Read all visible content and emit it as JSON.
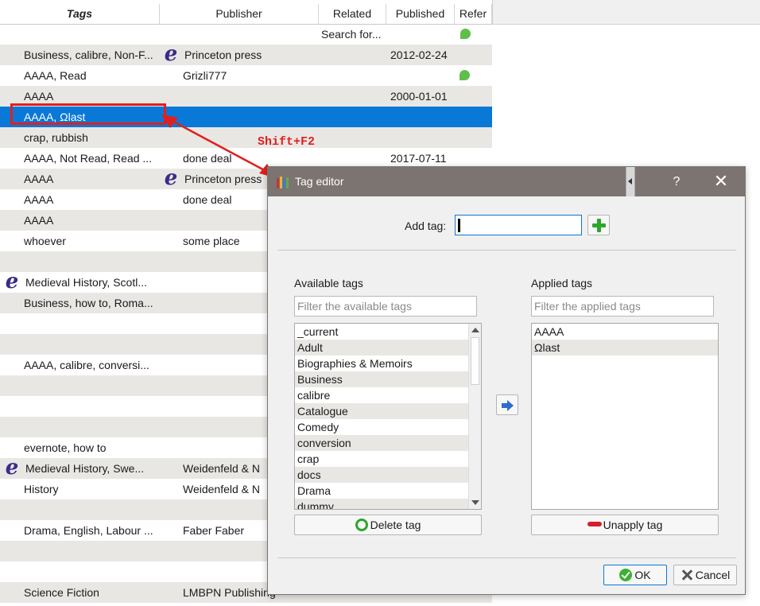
{
  "table": {
    "headers": [
      "Tags",
      "Publisher",
      "Related",
      "Published",
      "Refer"
    ],
    "search_placeholder": "Search for...",
    "rows": [
      {
        "tags": "Business, calibre, Non-F...",
        "publisher": "Princeton press",
        "published": "2012-02-24",
        "e_publisher": true,
        "ref": false,
        "alt": true
      },
      {
        "tags": "AAAA, Read",
        "publisher": "Grizli777",
        "published": "",
        "ref": true,
        "alt": false
      },
      {
        "tags": "AAAA",
        "publisher": "",
        "published": "2000-01-01",
        "alt": true
      },
      {
        "tags": "AAAA, Ωlast",
        "publisher": "",
        "published": "",
        "selected": true
      },
      {
        "tags": "crap, rubbish",
        "publisher": "",
        "published": "",
        "alt": true
      },
      {
        "tags": "AAAA, Not Read, Read ...",
        "publisher": "done deal",
        "published": "2017-07-11",
        "alt": false
      },
      {
        "tags": "AAAA",
        "publisher": "Princeton press",
        "published": "",
        "e_publisher": true,
        "alt": true
      },
      {
        "tags": "AAAA",
        "publisher": "done deal",
        "published": "",
        "alt": false
      },
      {
        "tags": "AAAA",
        "publisher": "",
        "published": "",
        "alt": true
      },
      {
        "tags": "whoever",
        "publisher": "some place",
        "published": "",
        "alt": false
      },
      {
        "tags": "",
        "publisher": "",
        "published": "",
        "alt": true
      },
      {
        "tags": "Medieval History, Scotl...",
        "publisher": "",
        "published": "",
        "e_tags": true,
        "alt": false
      },
      {
        "tags": "Business, how to, Roma...",
        "publisher": "",
        "published": "",
        "alt": true
      },
      {
        "tags": "",
        "publisher": "",
        "published": "",
        "alt": false
      },
      {
        "tags": "",
        "publisher": "",
        "published": "",
        "alt": true
      },
      {
        "tags": "AAAA, calibre, conversi...",
        "publisher": "",
        "published": "",
        "alt": false
      },
      {
        "tags": "",
        "publisher": "",
        "published": "",
        "alt": true
      },
      {
        "tags": "",
        "publisher": "",
        "published": "",
        "alt": false
      },
      {
        "tags": "",
        "publisher": "",
        "published": "",
        "alt": true
      },
      {
        "tags": "evernote, how to",
        "publisher": "",
        "published": "",
        "alt": false
      },
      {
        "tags": "Medieval History, Swe...",
        "publisher": "Weidenfeld & N",
        "published": "",
        "e_tags": true,
        "alt": true
      },
      {
        "tags": "History",
        "publisher": "Weidenfeld & N",
        "published": "",
        "alt": false
      },
      {
        "tags": "",
        "publisher": "",
        "published": "",
        "alt": true
      },
      {
        "tags": "Drama, English, Labour ...",
        "publisher": "Faber  Faber",
        "published": "",
        "alt": false
      },
      {
        "tags": "",
        "publisher": "",
        "published": "",
        "alt": true
      },
      {
        "tags": "",
        "publisher": "",
        "published": "",
        "alt": false
      },
      {
        "tags": "Science Fiction",
        "publisher": "LMBPN Publishing",
        "published": "",
        "alt": true
      }
    ]
  },
  "annotation": {
    "shortcut": "Shift+F2",
    "color": "#e0201e"
  },
  "dialog": {
    "title": "Tag editor",
    "help": "?",
    "close": "✕",
    "add_tag_label": "Add tag:",
    "add_tag_value": "",
    "available_label": "Available tags",
    "applied_label": "Applied tags",
    "filter_available_placeholder": "Filter the available tags",
    "filter_applied_placeholder": "Filter the applied tags",
    "available_tags": [
      "_current",
      "Adult",
      "Biographies & Memoirs",
      "Business",
      "calibre",
      "Catalogue",
      "Comedy",
      "conversion",
      "crap",
      "docs",
      "Drama",
      "dummy"
    ],
    "applied_tags": [
      "AAAA",
      "Ωlast"
    ],
    "delete_button": "Delete tag",
    "unapply_button": "Unapply tag",
    "ok_button": "OK",
    "cancel_button": "Cancel"
  },
  "colors": {
    "selection": "#0a78d7",
    "titlebar": "#7b7471",
    "row_alt": "#e9e7e4",
    "e_icon": "#3c2a8a"
  }
}
